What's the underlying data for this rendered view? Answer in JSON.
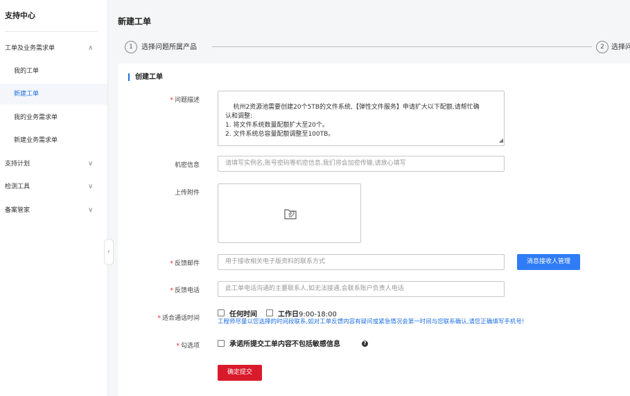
{
  "sidebar": {
    "title": "支持中心",
    "items": [
      {
        "label": "工单及业务需求单",
        "chevron": "∧"
      },
      {
        "label": "我的工单"
      },
      {
        "label": "新建工单"
      },
      {
        "label": "我的业务需求单"
      },
      {
        "label": "新建业务需求单"
      },
      {
        "label": "支持计划",
        "chevron": "∨"
      },
      {
        "label": "检测工具",
        "chevron": "∨"
      },
      {
        "label": "备案管家",
        "chevron": "∨"
      }
    ],
    "collapse_glyph": "‹"
  },
  "page": {
    "title": "新建工单",
    "steps": [
      {
        "num": "1",
        "label": "选择问题所属产品"
      },
      {
        "num": "2",
        "label": "选择问"
      }
    ]
  },
  "form": {
    "section_title": "创建工单",
    "problem": {
      "label": "问题描述",
      "value": "杭州2资源池需要创建20个5TB的文件系统,【弹性文件服务】申请扩大以下配额,请帮忙确\n认和调整:\n1. 将文件系统数量配额扩大至20个。\n2. 文件系统总容量配额调整至100TB。"
    },
    "secret": {
      "label": "机密信息",
      "placeholder": "请填写实例名,账号密码等机密信息,我们将会加密传输,请放心填写"
    },
    "attachment": {
      "label": "上传附件"
    },
    "email": {
      "label": "反馈邮件",
      "placeholder": "用于接收相关电子版资料的联系方式",
      "manage_button": "消息接收人管理"
    },
    "phone": {
      "label": "反馈电话",
      "placeholder": "此工单电话沟通的主要联系人,如无法接通,会联系账户负责人电话"
    },
    "call_time": {
      "label": "适合通话时间",
      "opt1": "任何时间",
      "opt2_prefix": "工作日",
      "opt2_time": "9:00-18:00",
      "hint": "工程师尽量以您选择的时间段联系,如对工单反馈内容有疑问或紧急情况会第一时间与您联系确认,请您正确填写手机号!"
    },
    "check": {
      "label": "勾选项",
      "text": "承诺所提交工单内容不包括敏感信息",
      "help": "?"
    },
    "submit": "确定提交",
    "required_mark": "*"
  },
  "colors": {
    "accent": "#2f7cf6",
    "submit": "#d91a2a",
    "required": "#e02020",
    "hint": "#1e6fe0"
  }
}
